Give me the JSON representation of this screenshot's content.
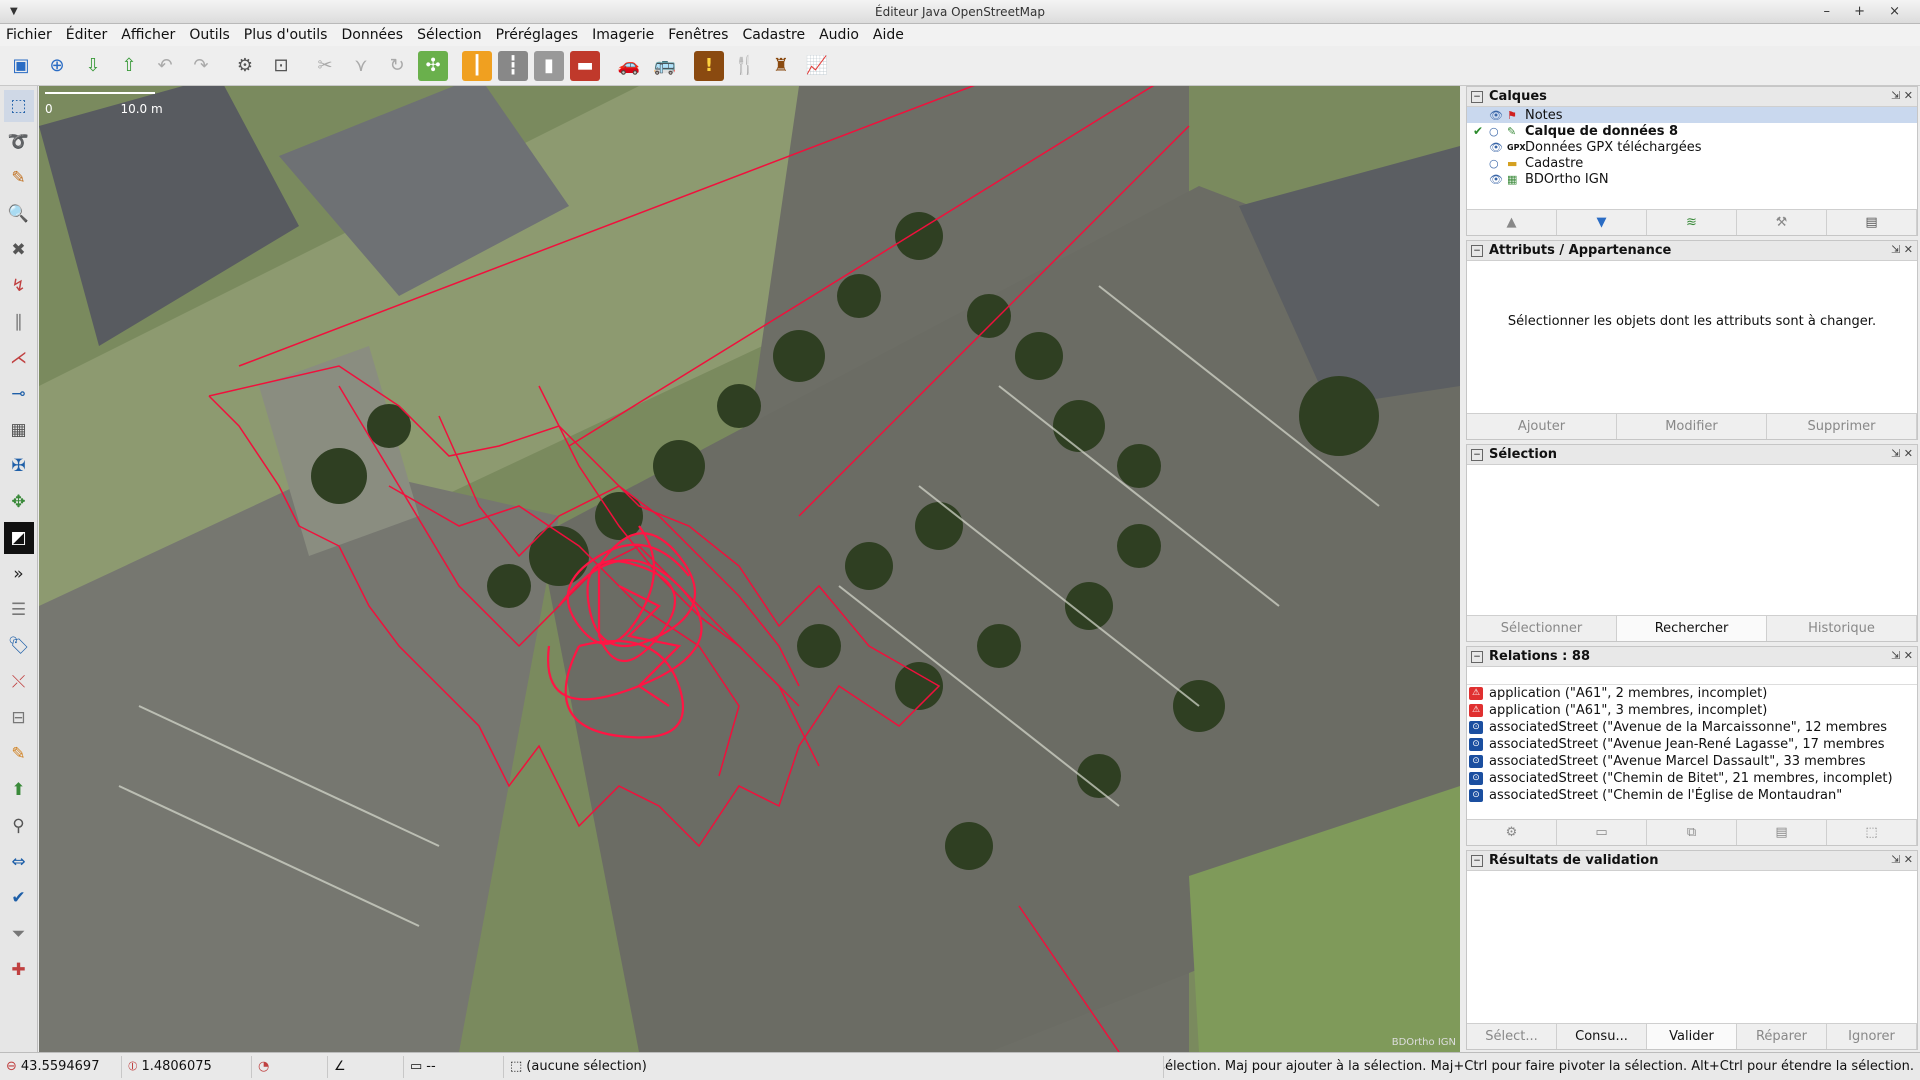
{
  "window": {
    "title": "Éditeur Java OpenStreetMap",
    "controls": "– + ×"
  },
  "menu": [
    "Fichier",
    "Éditer",
    "Afficher",
    "Outils",
    "Plus d'outils",
    "Données",
    "Sélection",
    "Préréglages",
    "Imagerie",
    "Fenêtres",
    "Cadastre",
    "Audio",
    "Aide"
  ],
  "toolbar": {
    "icons": [
      "open-file-icon",
      "open-location-icon",
      "download-icon",
      "upload-icon",
      "undo-icon",
      "redo-icon",
      "preferences-icon",
      "zoom-fit-icon",
      "split-way-icon",
      "merge-icon",
      "reverse-icon",
      "orthogonalize-icon",
      "highway-preset-icon",
      "path-preset-icon",
      "footway-preset-icon",
      "building-preset-icon",
      "car-preset-icon",
      "bus-preset-icon",
      "warning-preset-icon",
      "restaurant-preset-icon",
      "castle-preset-icon",
      "chart-preset-icon"
    ]
  },
  "lefttools": [
    "select-icon",
    "lasso-icon",
    "draw-icon",
    "zoom-icon",
    "delete-icon",
    "improve-way-icon",
    "parallel-icon",
    "split-icon",
    "extrude-icon",
    "building-icon",
    "align-icon",
    "terracer-icon",
    "imagery-icon",
    "more-icon",
    "layers-icon",
    "tags-icon",
    "relation-icon",
    "selection-list-icon",
    "note-icon",
    "changeset-icon",
    "filter-icon",
    "validator-icon",
    "map-paint-icon",
    "history-icon",
    "settings-icon"
  ],
  "map": {
    "scale_zero": "0",
    "scale_label": "10.0 m",
    "attribution": "BDOrtho IGN"
  },
  "layers": {
    "title": "Calques",
    "items": [
      {
        "name": "Notes",
        "active": false,
        "icon": "note-marker-icon"
      },
      {
        "name": "Calque de données 8",
        "active": true,
        "icon": "data-layer-icon"
      },
      {
        "name": "Données GPX téléchargées",
        "active": false,
        "icon": "gpx-icon"
      },
      {
        "name": "Cadastre",
        "active": false,
        "icon": "cadastre-icon"
      },
      {
        "name": "BDOrtho IGN",
        "active": false,
        "icon": "imagery-layer-icon"
      }
    ]
  },
  "attributes": {
    "title": "Attributs / Appartenance",
    "message": "Sélectionner les objets dont les attributs sont à changer.",
    "add": "Ajouter",
    "modify": "Modifier",
    "delete": "Supprimer"
  },
  "selection": {
    "title": "Sélection",
    "select": "Sélectionner",
    "search": "Rechercher",
    "history": "Historique"
  },
  "relations": {
    "title": "Relations : 88",
    "items": [
      {
        "text": "application (\"A61\", 2 membres, incomplet)",
        "color": "#e03030"
      },
      {
        "text": "application (\"A61\", 3 membres, incomplet)",
        "color": "#e03030"
      },
      {
        "text": "associatedStreet (\"Avenue de la Marcaissonne\", 12 membres",
        "color": "#1b4fa0"
      },
      {
        "text": "associatedStreet (\"Avenue Jean-René Lagasse\", 17 membres",
        "color": "#1b4fa0"
      },
      {
        "text": "associatedStreet (\"Avenue Marcel Dassault\", 33 membres",
        "color": "#1b4fa0"
      },
      {
        "text": "associatedStreet (\"Chemin de Bitet\", 21 membres, incomplet)",
        "color": "#1b4fa0"
      },
      {
        "text": "associatedStreet (\"Chemin de l'Église de Montaudran\"",
        "color": "#1b4fa0"
      }
    ]
  },
  "validation": {
    "title": "Résultats de validation",
    "select": "Sélect...",
    "consult": "Consu...",
    "validate": "Valider",
    "repair": "Réparer",
    "ignore": "Ignorer"
  },
  "status": {
    "lat": "43.5594697",
    "lon": "1.4806075",
    "length": "--",
    "selection": "(aucune sélection)",
    "help": "sélection. Maj pour ajouter à la sélection. Maj+Ctrl pour faire pivoter la sélection. Alt+Ctrl pour étendre la sélection."
  }
}
